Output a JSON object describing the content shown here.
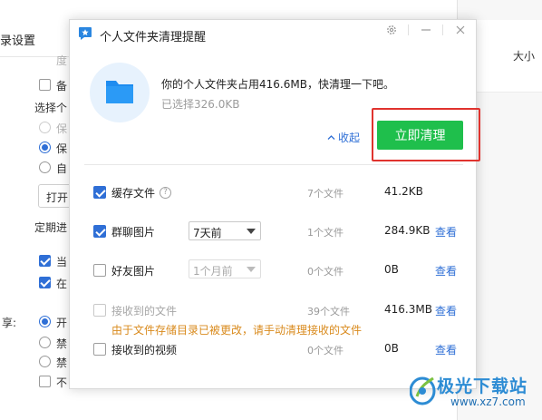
{
  "background": {
    "title": "录设置",
    "items": [
      {
        "text": "度",
        "dim": true
      },
      {
        "text": "备",
        "dim": false
      },
      {
        "text": "选择个",
        "dim": false
      },
      {
        "text": "保",
        "dim": true
      },
      {
        "text": "保",
        "dim": false
      },
      {
        "text": "自",
        "dim": false
      },
      {
        "text": "打开",
        "dim": false
      },
      {
        "text": "定期进",
        "dim": false
      },
      {
        "text": "当",
        "dim": false
      },
      {
        "text": "在",
        "dim": false
      },
      {
        "text": "享:",
        "dim": false
      },
      {
        "text": "开",
        "dim": false
      },
      {
        "text": "禁",
        "dim": false
      },
      {
        "text": "禁",
        "dim": false
      },
      {
        "text": "不",
        "dim": false
      }
    ],
    "right_header": "大小"
  },
  "dialog": {
    "title": "个人文件夹清理提醒",
    "summary": "你的个人文件夹占用416.6MB，快清理一下吧。",
    "selected": "已选择326.0KB",
    "collapse_label": "收起",
    "clean_button": "立即清理",
    "warning": "由于文件存储目录已被更改，请手动清理接收的文件",
    "rows": [
      {
        "name": "缓存文件",
        "checked": true,
        "disabled": false,
        "count": "7个文件",
        "size": "41.2KB",
        "view": ""
      },
      {
        "name": "群聊图片",
        "checked": true,
        "disabled": false,
        "select": "7天前",
        "count": "1个文件",
        "size": "284.9KB",
        "view": "查看"
      },
      {
        "name": "好友图片",
        "checked": false,
        "disabled": false,
        "select": "1个月前",
        "count": "0个文件",
        "size": "0B",
        "view": "查看"
      },
      {
        "name": "接收到的文件",
        "checked": false,
        "disabled": true,
        "count": "39个文件",
        "size": "416.3MB",
        "view": "查看"
      },
      {
        "name": "接收到的视频",
        "checked": false,
        "disabled": false,
        "count": "0个文件",
        "size": "0B",
        "view": "查看"
      }
    ],
    "icons": [
      "settings-icon",
      "minimize-icon",
      "close-icon",
      "folder-icon",
      "help-icon",
      "chevron-up-icon"
    ],
    "colors": {
      "accent": "#2f6fd6",
      "primary_button": "#1fbf4c",
      "highlight_box": "#e0332e",
      "warning": "#d98a1c"
    }
  },
  "watermark": {
    "text": "极光下载站",
    "url": "www.xz7.com"
  }
}
